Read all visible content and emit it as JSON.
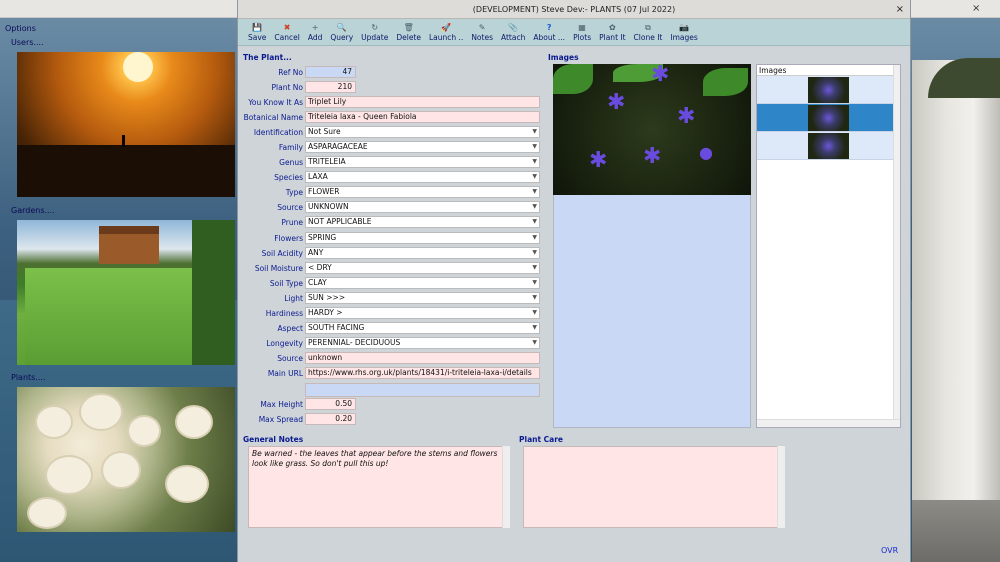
{
  "window": {
    "title": "(DEVELOPMENT) Steve Dev:-  PLANTS (07 Jul 2022)",
    "close": "×"
  },
  "outer_close": "×",
  "left_panel": {
    "options_label": "Options",
    "users_label": "Users....",
    "gardens_label": "Gardens....",
    "plants_label": "Plants...."
  },
  "toolbar": [
    {
      "icon": "💾",
      "label": "Save"
    },
    {
      "icon": "✖",
      "label": "Cancel"
    },
    {
      "icon": "+",
      "label": "Add"
    },
    {
      "icon": "🔍",
      "label": "Query"
    },
    {
      "icon": "↻",
      "label": "Update"
    },
    {
      "icon": "🗑",
      "label": "Delete"
    },
    {
      "icon": "🚀",
      "label": "Launch .."
    },
    {
      "icon": "✎",
      "label": "Notes"
    },
    {
      "icon": "📎",
      "label": "Attach"
    },
    {
      "icon": "?",
      "label": "About ..."
    },
    {
      "icon": "▦",
      "label": "Plots"
    },
    {
      "icon": "✿",
      "label": "Plant It"
    },
    {
      "icon": "⧉",
      "label": "Clone It"
    },
    {
      "icon": "📷",
      "label": "Images"
    }
  ],
  "form": {
    "section_title": "The Plant...",
    "ref_no_label": "Ref No",
    "ref_no": "47",
    "plant_no_label": "Plant No",
    "plant_no": "210",
    "known_as_label": "You Know It As",
    "known_as": "Triplet Lily",
    "botanical_label": "Botanical Name",
    "botanical": "Triteleia laxa - Queen Fabiola",
    "identification_label": "Identification",
    "identification": "Not Sure",
    "family_label": "Family",
    "family": "ASPARAGACEAE",
    "genus_label": "Genus",
    "genus": "TRITELEIA",
    "species_label": "Species",
    "species": "LAXA",
    "type_label": "Type",
    "type": "FLOWER",
    "source_sel_label": "Source",
    "source_sel": "UNKNOWN",
    "prune_label": "Prune",
    "prune": "NOT APPLICABLE",
    "flowers_label": "Flowers",
    "flowers": "SPRING",
    "soil_acidity_label": "Soil Acidity",
    "soil_acidity": "ANY",
    "soil_moisture_label": "Soil Moisture",
    "soil_moisture": "< DRY",
    "soil_type_label": "Soil Type",
    "soil_type": "CLAY",
    "light_label": "Light",
    "light": "SUN >>>",
    "hardiness_label": "Hardiness",
    "hardiness": "HARDY >",
    "aspect_label": "Aspect",
    "aspect": "SOUTH FACING",
    "longevity_label": "Longevity",
    "longevity": "PERENNIAL- DECIDUOUS",
    "source_label": "Source",
    "source": "unknown",
    "main_url_label": "Main URL",
    "main_url": "https://www.rhs.org.uk/plants/18431/i-triteleia-laxa-i/details",
    "extra_field": "",
    "max_height_label": "Max Height",
    "max_height": "0.50",
    "max_spread_label": "Max Spread",
    "max_spread": "0.20"
  },
  "images": {
    "section_title": "Images",
    "list_header": "Images",
    "count": 3,
    "selected_index": 1
  },
  "general_notes": {
    "title": "General Notes",
    "text": "Be warned - the leaves that appear before the stems and flowers look like grass. So don't pull this up!"
  },
  "plant_care": {
    "title": "Plant Care",
    "text": ""
  },
  "status": {
    "mode": "OVR"
  }
}
